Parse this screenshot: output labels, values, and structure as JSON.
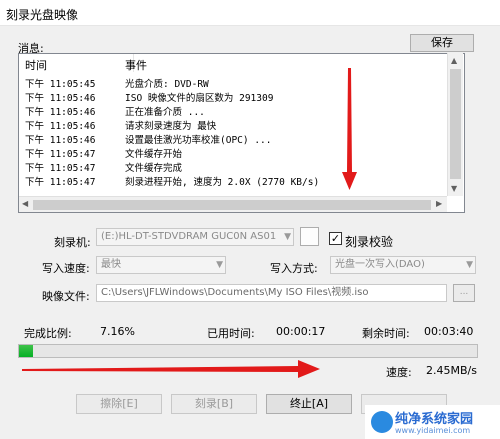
{
  "window": {
    "title": "刻录光盘映像"
  },
  "messages": {
    "label": "消息:",
    "save_label": "保存",
    "columns": [
      "时间",
      "事件"
    ],
    "rows": [
      {
        "time": "下午 11:05:45",
        "event": "光盘介质: DVD-RW"
      },
      {
        "time": "下午 11:05:46",
        "event": "ISO 映像文件的扇区数为 291309"
      },
      {
        "time": "下午 11:05:46",
        "event": "正在准备介质 ..."
      },
      {
        "time": "下午 11:05:46",
        "event": "请求刻录速度为 最快"
      },
      {
        "time": "下午 11:05:46",
        "event": "设置最佳激光功率校准(OPC) ..."
      },
      {
        "time": "下午 11:05:47",
        "event": "文件缓存开始"
      },
      {
        "time": "下午 11:05:47",
        "event": "文件缓存完成"
      },
      {
        "time": "下午 11:05:47",
        "event": "刻录进程开始, 速度为 2.0X (2770 KB/s)"
      }
    ]
  },
  "settings": {
    "recorder_label": "刻录机:",
    "recorder_value": "(E:)HL-DT-STDVDRAM GUC0N    AS01",
    "verify_label": "刻录校验",
    "verify_checked": true,
    "write_speed_label": "写入速度:",
    "write_speed_value": "最快",
    "write_method_label": "写入方式:",
    "write_method_value": "光盘一次写入(DAO)",
    "image_file_label": "映像文件:",
    "image_file_value": "C:\\Users\\JFLWindows\\Documents\\My ISO Files\\视频.iso",
    "browse_label": "..."
  },
  "progress": {
    "completed_label": "完成比例:",
    "completed_value": "7.16%",
    "completed_fraction": 0.0716,
    "elapsed_label": "已用时间:",
    "elapsed_value": "00:00:17",
    "remaining_label": "剩余时间:",
    "remaining_value": "00:03:40",
    "speed_label": "速度:",
    "speed_value": "2.45MB/s"
  },
  "buttons": {
    "erase": "擦除[E]",
    "burn": "刻录[B]",
    "abort": "终止[A]"
  },
  "watermark": {
    "title": "纯净系统家园",
    "url": "www.yidaimei.com"
  },
  "colors": {
    "progress_green": "#06b025",
    "annotation_red": "#e21a1a"
  }
}
